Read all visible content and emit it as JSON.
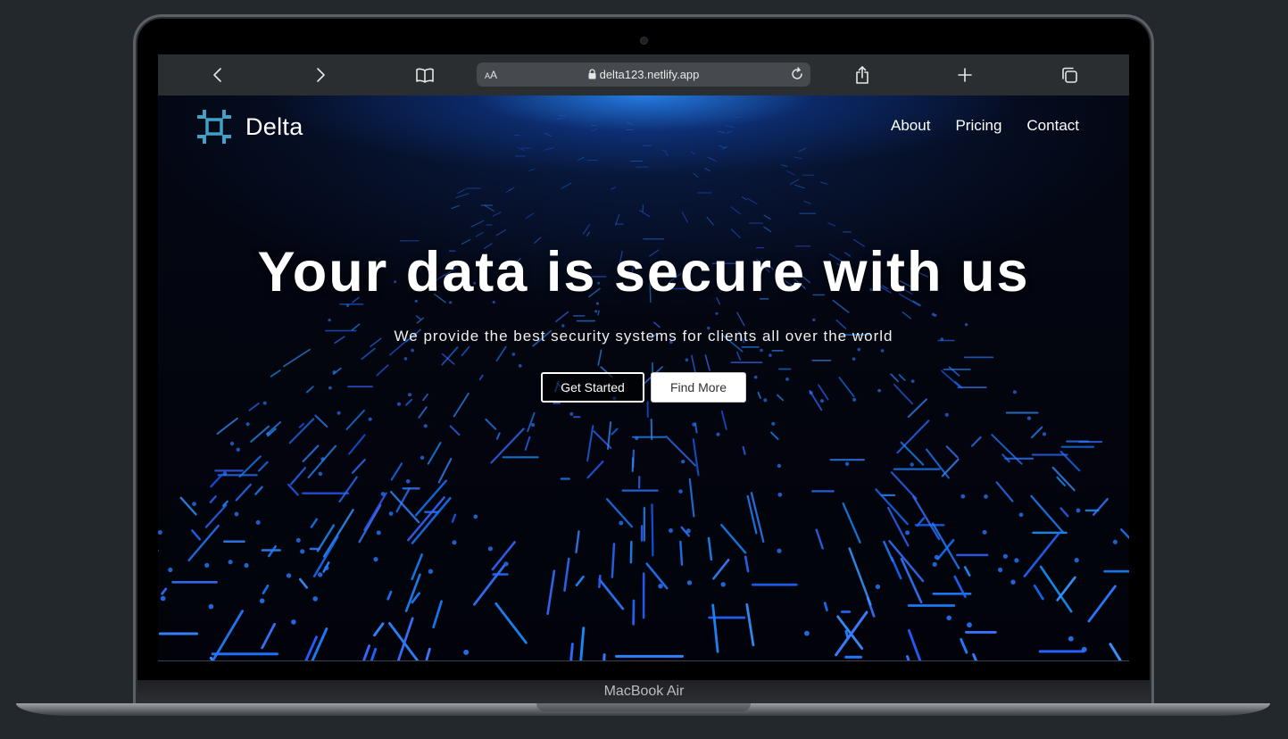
{
  "device": {
    "label": "MacBook Air"
  },
  "browser": {
    "text_size_label_small": "A",
    "text_size_label_large": "A",
    "url": "delta123.netlify.app",
    "icons": [
      "chevron-left-icon",
      "chevron-right-icon",
      "book-icon",
      "lock-icon",
      "reload-icon",
      "share-icon",
      "plus-icon",
      "tabs-icon"
    ]
  },
  "site": {
    "brand": "Delta",
    "nav": [
      "About",
      "Pricing",
      "Contact"
    ],
    "hero": {
      "title": "Your data is secure with us",
      "subtitle": "We provide the best security systems for clients all over the world",
      "primary_button": "Get Started",
      "secondary_button": "Find More"
    },
    "colors": {
      "accent": "#1e6cff",
      "logo": "#3fa0c8",
      "background": "#02030a"
    }
  }
}
